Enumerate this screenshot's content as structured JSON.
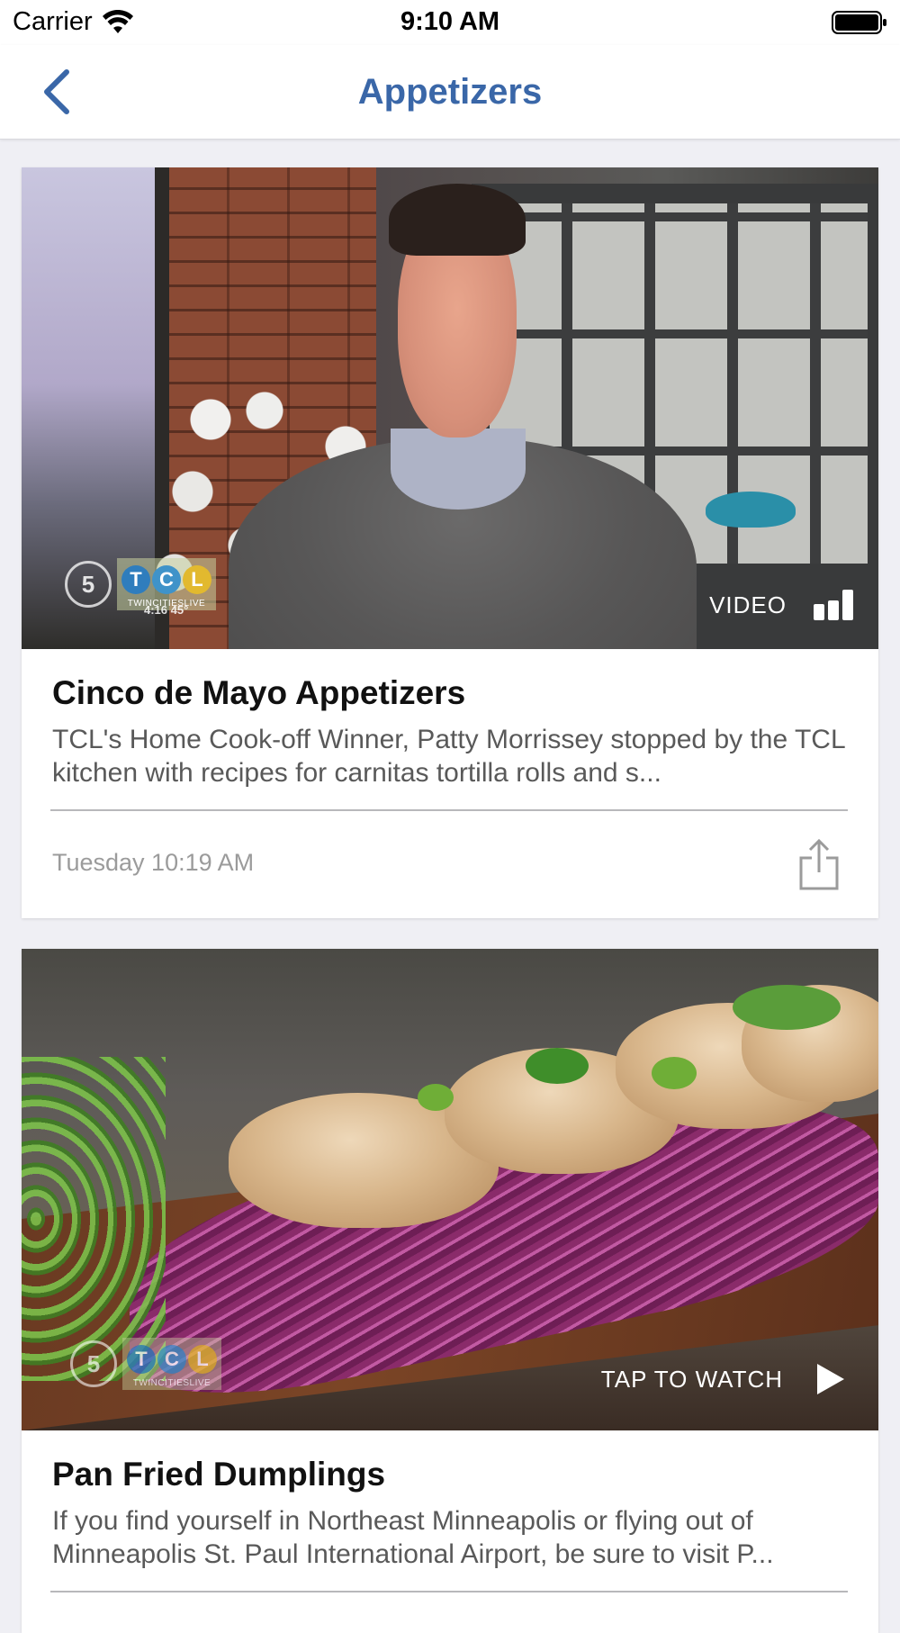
{
  "status_bar": {
    "carrier": "Carrier",
    "time": "9:10 AM"
  },
  "nav": {
    "title": "Appetizers",
    "back_icon": "chevron-left-icon",
    "accent_color": "#3a67a8"
  },
  "cards": [
    {
      "title": "Cinco de Mayo Appetizers",
      "description": "TCL's Home Cook-off Winner, Patty Morrissey stopped by the TCL kitchen with recipes for carnitas tortilla rolls and s...",
      "date": "Tuesday 10:19 AM",
      "media_badge": "VIDEO",
      "badge_icon": "signal-bars-icon",
      "logo": {
        "channel": "5",
        "letters": [
          "T",
          "C",
          "L"
        ],
        "subtitle": "TWINCITIESLIVE",
        "overlay_text": "4:16   45°"
      },
      "share_icon": "share-icon"
    },
    {
      "title": "Pan Fried Dumplings",
      "description": "If you find yourself in Northeast Minneapolis or flying out of Minneapolis St. Paul International Airport, be sure to visit P...",
      "media_badge": "TAP TO WATCH",
      "badge_icon": "play-icon",
      "logo": {
        "channel": "5",
        "letters": [
          "T",
          "C",
          "L"
        ],
        "subtitle": "TWINCITIESLIVE"
      }
    }
  ]
}
